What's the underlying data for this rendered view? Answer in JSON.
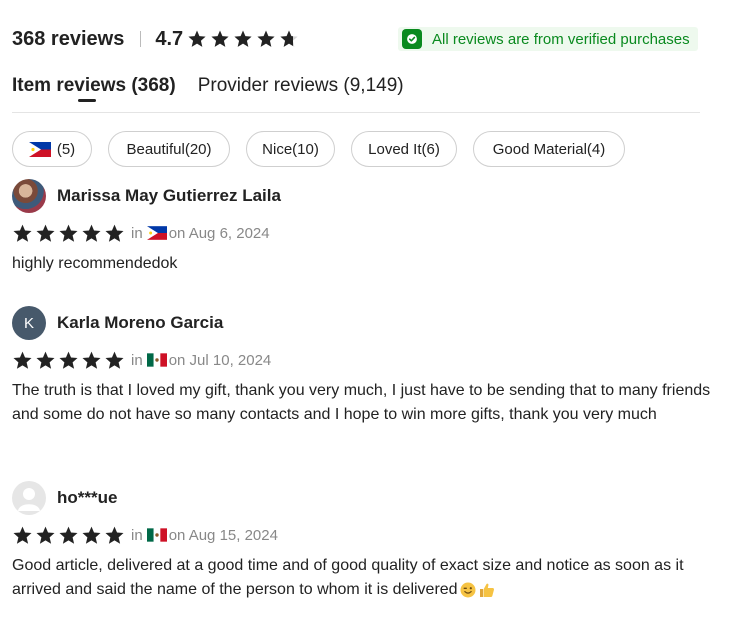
{
  "summary": {
    "review_count": "368 reviews",
    "rating": "4.7",
    "rating_value": 4.7,
    "star_color": "#222222"
  },
  "verified": {
    "text": "All reviews are from verified purchases",
    "color": "#0a8a1f",
    "icon": "shield-check-icon"
  },
  "tabs": [
    {
      "label": "Item reviews (368)",
      "active": true
    },
    {
      "label": "Provider reviews (9,149)",
      "active": false
    }
  ],
  "filters": [
    {
      "label": "(5)",
      "flag": "philippines-flag-icon"
    },
    {
      "label": "Beautiful(20)"
    },
    {
      "label": "Nice(10)"
    },
    {
      "label": "Loved It(6)"
    },
    {
      "label": "Good Material(4)"
    }
  ],
  "reviews": [
    {
      "name": "Marissa May Gutierrez Laila",
      "avatar": "photo",
      "stars": 5,
      "in_label": "in",
      "country_flag": "philippines-flag-icon",
      "date": "on Aug 6, 2024",
      "text": "highly recommendedok"
    },
    {
      "name": "Karla Moreno Garcia",
      "avatar_initial": "K",
      "stars": 5,
      "in_label": "in",
      "country_flag": "mexico-flag-icon",
      "date": "on Jul 10, 2024",
      "text": "The truth is that I loved my gift, thank you very much, I just have to be sending that to many friends and some do not have so many contacts and I hope to win more gifts, thank you very much"
    },
    {
      "name": "ho***ue",
      "avatar": "default-user",
      "stars": 5,
      "in_label": "in",
      "country_flag": "mexico-flag-icon",
      "date": "on Aug 15, 2024",
      "text": "Good article, delivered at a good time and of good quality of exact size and notice as soon as it arrived and said the name of the person to whom it is delivered",
      "emojis": [
        "wink-emoji-icon",
        "thumbs-up-emoji-icon"
      ]
    }
  ]
}
